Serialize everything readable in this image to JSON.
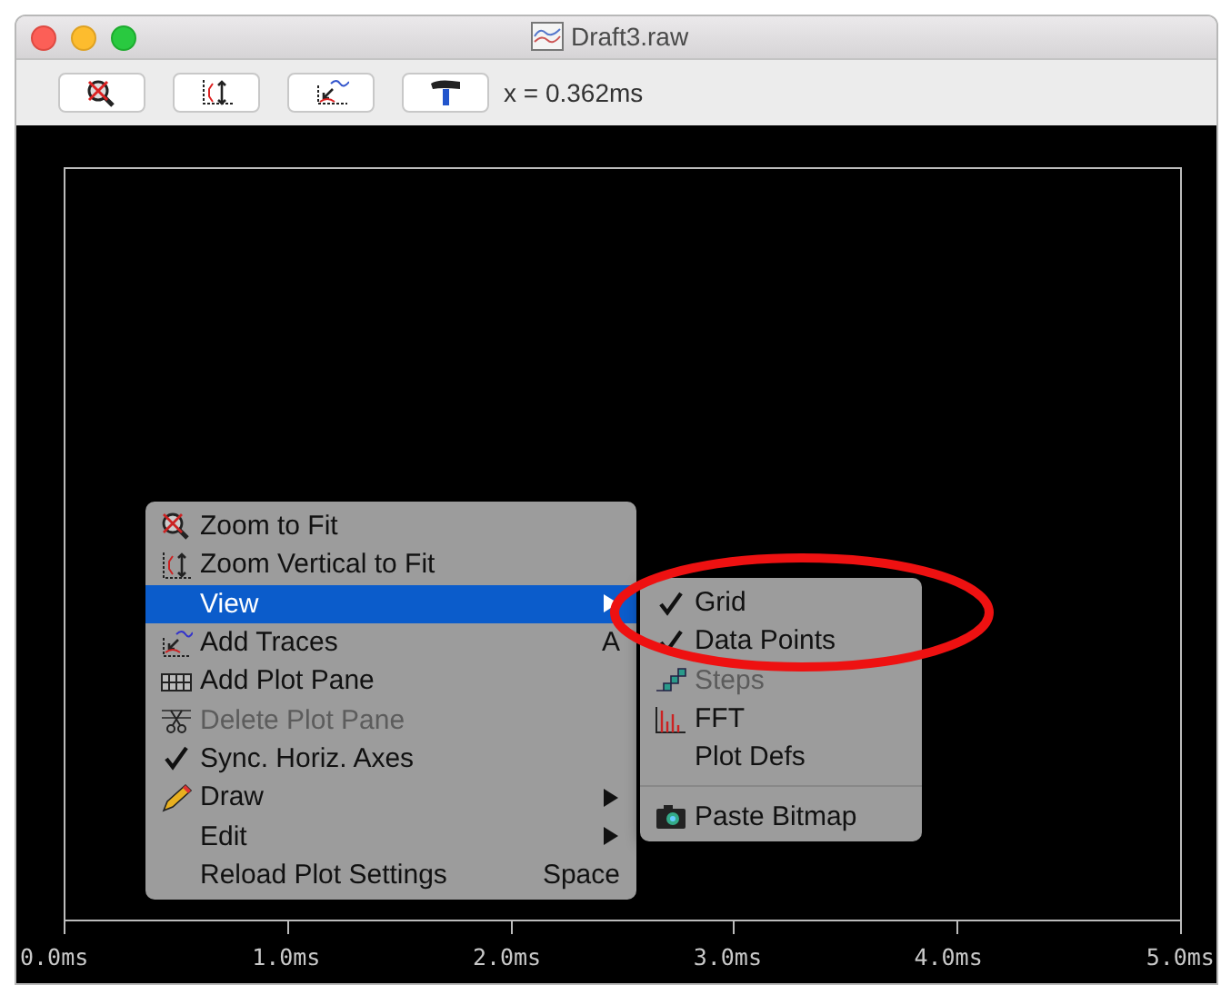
{
  "window": {
    "title": "Draft3.raw"
  },
  "toolbar": {
    "readout": "x = 0.362ms"
  },
  "plot": {
    "x_tick_labels": [
      "0.0ms",
      "1.0ms",
      "2.0ms",
      "3.0ms",
      "4.0ms",
      "5.0ms"
    ]
  },
  "context_menu": {
    "items": [
      {
        "kind": "command",
        "label": "Zoom to Fit",
        "checked": false,
        "disabled": false,
        "selected": false
      },
      {
        "kind": "command",
        "label": "Zoom Vertical to Fit",
        "checked": false,
        "disabled": false,
        "selected": false
      },
      {
        "kind": "submenu",
        "label": "View",
        "checked": false,
        "disabled": false,
        "selected": true
      },
      {
        "kind": "command",
        "label": "Add Traces",
        "shortcut": "A",
        "checked": false,
        "disabled": false,
        "selected": false
      },
      {
        "kind": "command",
        "label": "Add Plot Pane",
        "checked": false,
        "disabled": false,
        "selected": false
      },
      {
        "kind": "command",
        "label": "Delete Plot Pane",
        "checked": false,
        "disabled": true,
        "selected": false
      },
      {
        "kind": "command",
        "label": "Sync. Horiz. Axes",
        "checked": true,
        "disabled": false,
        "selected": false
      },
      {
        "kind": "submenu",
        "label": "Draw",
        "checked": false,
        "disabled": false,
        "selected": false
      },
      {
        "kind": "submenu",
        "label": "Edit",
        "checked": false,
        "disabled": false,
        "selected": false
      },
      {
        "kind": "command",
        "label": "Reload Plot Settings",
        "shortcut": "Space",
        "checked": false,
        "disabled": false,
        "selected": false
      }
    ]
  },
  "view_submenu": {
    "items": [
      {
        "kind": "command",
        "label": "Grid",
        "checked": true,
        "disabled": false,
        "selected": false
      },
      {
        "kind": "command",
        "label": "Data Points",
        "checked": true,
        "disabled": false,
        "selected": false
      },
      {
        "kind": "command",
        "label": "Steps",
        "checked": false,
        "disabled": true,
        "selected": false
      },
      {
        "kind": "command",
        "label": "FFT",
        "checked": false,
        "disabled": false,
        "selected": false
      },
      {
        "kind": "command",
        "label": "Plot Defs",
        "checked": false,
        "disabled": false,
        "selected": false
      },
      {
        "kind": "separator"
      },
      {
        "kind": "command",
        "label": "Paste Bitmap",
        "checked": false,
        "disabled": false,
        "selected": false
      }
    ]
  }
}
